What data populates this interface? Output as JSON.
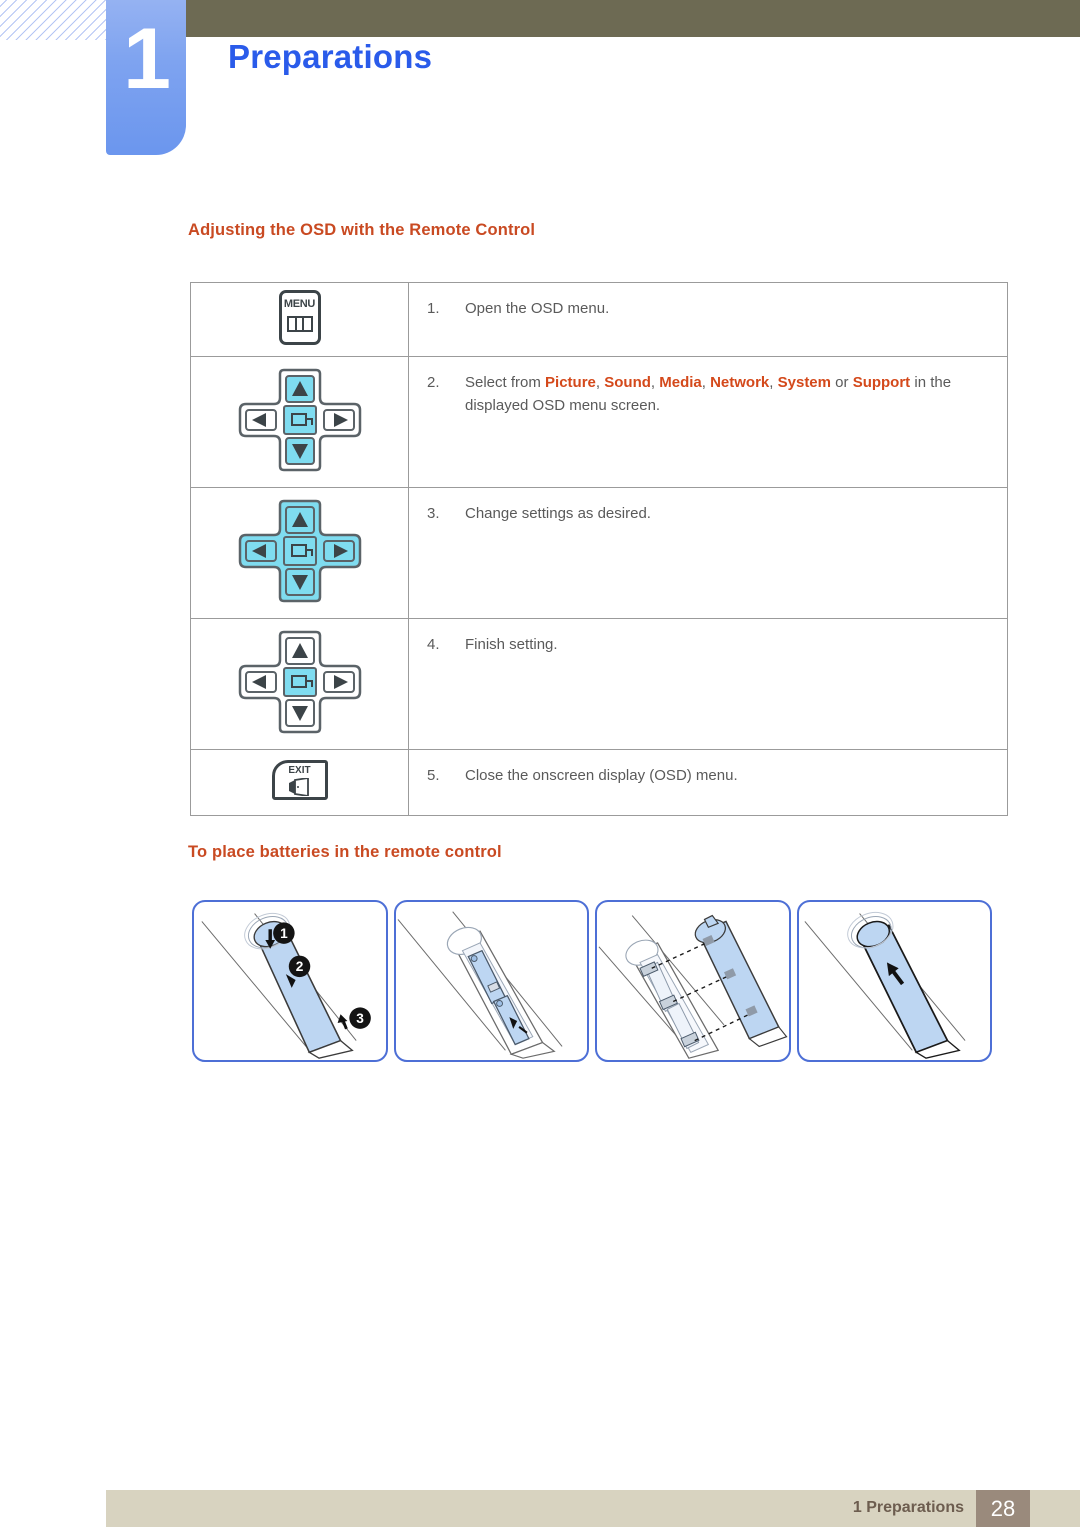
{
  "chapter": {
    "number": "1",
    "title": "Preparations"
  },
  "sections": {
    "osd_heading": "Adjusting the OSD with the Remote Control",
    "battery_heading": "To place batteries in the remote control"
  },
  "osd_steps": [
    {
      "number": "1.",
      "icon": "menu-button-icon",
      "icon_label": "MENU",
      "text": "Open the OSD menu.",
      "text_parts": [
        {
          "t": "Open the OSD menu.",
          "bold": false
        }
      ]
    },
    {
      "number": "2.",
      "icon": "dpad-up-down-enter-icon",
      "text": "Select from Picture, Sound, Media, Network, System or Support in the displayed OSD menu screen.",
      "text_parts": [
        {
          "t": "Select from ",
          "bold": false
        },
        {
          "t": "Picture",
          "bold": true
        },
        {
          "t": ", ",
          "bold": false
        },
        {
          "t": "Sound",
          "bold": true
        },
        {
          "t": ", ",
          "bold": false
        },
        {
          "t": "Media",
          "bold": true
        },
        {
          "t": ", ",
          "bold": false
        },
        {
          "t": "Network",
          "bold": true
        },
        {
          "t": ", ",
          "bold": false
        },
        {
          "t": "System",
          "bold": true
        },
        {
          "t": " or ",
          "bold": false
        },
        {
          "t": "Support",
          "bold": true
        },
        {
          "t": " in the displayed OSD menu screen.",
          "bold": false
        }
      ]
    },
    {
      "number": "3.",
      "icon": "dpad-all-icon",
      "text": "Change settings as desired.",
      "text_parts": [
        {
          "t": "Change settings as desired.",
          "bold": false
        }
      ]
    },
    {
      "number": "4.",
      "icon": "dpad-enter-icon",
      "text": "Finish setting.",
      "text_parts": [
        {
          "t": "Finish setting.",
          "bold": false
        }
      ]
    },
    {
      "number": "5.",
      "icon": "exit-button-icon",
      "icon_label": "EXIT",
      "text": "Close the onscreen display (OSD) menu.",
      "text_parts": [
        {
          "t": "Close the onscreen display (OSD) menu.",
          "bold": false
        }
      ]
    }
  ],
  "battery_panels": [
    {
      "name": "open-cover",
      "callouts": [
        "1",
        "2",
        "3"
      ]
    },
    {
      "name": "insert-batteries",
      "callouts": []
    },
    {
      "name": "align-cover",
      "callouts": []
    },
    {
      "name": "close-cover",
      "callouts": []
    }
  ],
  "footer": {
    "label": "1 Preparations",
    "page": "28"
  },
  "colors": {
    "accent_heading": "#c94a22",
    "keyword": "#d4491b",
    "chapter_blue": "#2a5bea",
    "tab_blue": "#7ea3f0",
    "olive": "#6d6a53",
    "footer_beige": "#d8d3c0",
    "footer_page_brown": "#9a8a7c",
    "highlight_cyan": "#7fdcf0",
    "body_text": "#5a5a5a",
    "panel_border": "#4d6fd6",
    "remote_fill": "#bdd6f2"
  }
}
